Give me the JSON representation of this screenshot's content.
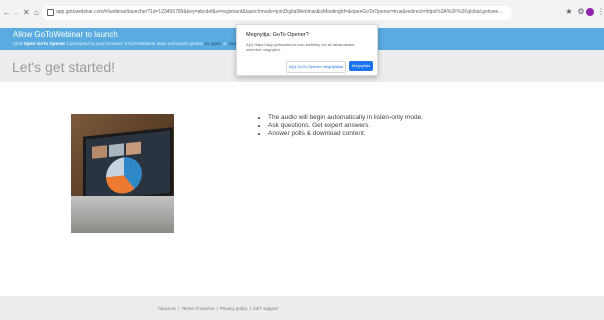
{
  "browser": {
    "nav": {
      "back": "←",
      "forward": "→",
      "reload": "✕",
      "home": "⌂"
    },
    "url": "app.gotowebinar.com/#/webinar/launcher?1d=123456789&key=abcdef&u=registrant&launchmode=joinDigitalWebinar&isMeetingId=&openGoToOpener=true&redirect=https%3A%2F%2Fglobal.gotowebinar.com%2Fjoin",
    "icons": [
      "lock-icon",
      "star-icon",
      "extension-icon",
      "profile-avatar",
      "menu-icon"
    ],
    "ext1": "★",
    "ext2": "⚙",
    "menu": "⋮"
  },
  "banner": {
    "title": "Allow GoToWebinar to launch",
    "sub_prefix": "Click ",
    "sub_bold": "Open GoTo Opener",
    "sub_middle": " if prompted by your browser. If GoToWebinar does not launch please ",
    "sub_link1": "try again",
    "sub_link2": "download",
    "sub_suffix": " or "
  },
  "page": {
    "heading": "Let's get started!"
  },
  "bullets": [
    "The audio will begin automatically in listen-only mode.",
    "Ask questions. Get expert answers.",
    "Answer polls & download content."
  ],
  "footer": {
    "links": [
      "About us",
      "Terms of service",
      "Privacy policy",
      "24/7 support"
    ],
    "sep": " | "
  },
  "dialog": {
    "title": "Megnyitja: GoTo Opener?",
    "body": "A(z) https://app.gotowebinar.com webhely ezt az alkalmazást szeretné megnyitni.",
    "always_label": "A(z) GoTo Opener megnyitása",
    "open_label": "Megnyitás"
  },
  "colors": {
    "banner": "#5aace0",
    "accent": "#1a73e8",
    "heading_strip": "#ededed",
    "footer": "#ececec"
  }
}
